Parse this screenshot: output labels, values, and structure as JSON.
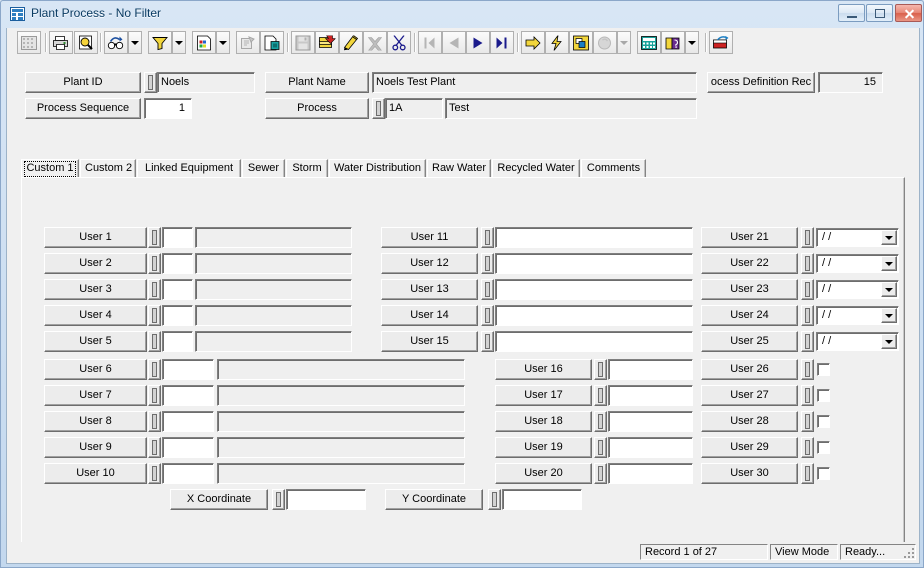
{
  "window": {
    "title": "Plant Process - No Filter",
    "icon": "grid-table-icon",
    "buttons": {
      "minimize": "minimize-button",
      "maximize": "restore-button",
      "close": "close-button"
    }
  },
  "toolbar": {
    "items": [
      {
        "name": "grid-view-icon",
        "enabled": false,
        "dropdown": false
      },
      {
        "name": "print-icon",
        "enabled": true,
        "dropdown": false
      },
      {
        "name": "print-preview-icon",
        "enabled": true,
        "dropdown": false
      },
      {
        "name": "find-icon",
        "enabled": true,
        "dropdown": true
      },
      {
        "name": "filter-icon",
        "enabled": true,
        "dropdown": true
      },
      {
        "name": "report-icon",
        "enabled": true,
        "dropdown": true
      },
      {
        "name": "form-design-icon",
        "enabled": false,
        "dropdown": false
      },
      {
        "name": "copy-record-icon",
        "enabled": true,
        "dropdown": false
      },
      {
        "name": "save-icon",
        "enabled": false,
        "dropdown": false
      },
      {
        "name": "add-record-icon",
        "enabled": true,
        "dropdown": false
      },
      {
        "name": "edit-record-icon",
        "enabled": true,
        "dropdown": false
      },
      {
        "name": "delete-record-icon",
        "enabled": false,
        "dropdown": false
      },
      {
        "name": "cut-icon",
        "enabled": true,
        "dropdown": false
      },
      {
        "name": "first-record-icon",
        "enabled": false,
        "dropdown": false
      },
      {
        "name": "previous-record-icon",
        "enabled": false,
        "dropdown": false
      },
      {
        "name": "next-record-icon",
        "enabled": true,
        "dropdown": false
      },
      {
        "name": "last-record-icon",
        "enabled": true,
        "dropdown": false
      },
      {
        "name": "goto-icon",
        "enabled": true,
        "dropdown": false
      },
      {
        "name": "quick-action-icon",
        "enabled": true,
        "dropdown": false
      },
      {
        "name": "map-icon",
        "enabled": true,
        "dropdown": false
      },
      {
        "name": "attachment-icon",
        "enabled": false,
        "dropdown": true
      },
      {
        "name": "calculator-icon",
        "enabled": true,
        "dropdown": false
      },
      {
        "name": "help-book-icon",
        "enabled": true,
        "dropdown": true
      },
      {
        "name": "exit-icon",
        "enabled": true,
        "dropdown": false
      }
    ]
  },
  "header": {
    "plant_id": {
      "label": "Plant ID",
      "value": "Noels"
    },
    "plant_name": {
      "label": "Plant Name",
      "value": "Noels Test Plant"
    },
    "process_definition": {
      "label": "ocess Definition Rec",
      "value": "15"
    },
    "process_sequence": {
      "label": "Process Sequence",
      "value": "1"
    },
    "process": {
      "label": "Process",
      "value": "1A",
      "description": "Test"
    }
  },
  "tabs": [
    {
      "label": "Custom 1",
      "selected": true
    },
    {
      "label": "Custom 2",
      "selected": false
    },
    {
      "label": "Linked Equipment",
      "selected": false
    },
    {
      "label": "Sewer",
      "selected": false
    },
    {
      "label": "Storm",
      "selected": false
    },
    {
      "label": "Water Distribution",
      "selected": false
    },
    {
      "label": "Raw Water",
      "selected": false
    },
    {
      "label": "Recycled Water",
      "selected": false
    },
    {
      "label": "Comments",
      "selected": false
    }
  ],
  "custom1": {
    "col_a": [
      {
        "label": "User 1",
        "value": "",
        "desc": ""
      },
      {
        "label": "User 2",
        "value": "",
        "desc": ""
      },
      {
        "label": "User 3",
        "value": "",
        "desc": ""
      },
      {
        "label": "User 4",
        "value": "",
        "desc": ""
      },
      {
        "label": "User 5",
        "value": "",
        "desc": ""
      }
    ],
    "col_a2": [
      {
        "label": "User 6",
        "value": "",
        "desc": ""
      },
      {
        "label": "User 7",
        "value": "",
        "desc": ""
      },
      {
        "label": "User 8",
        "value": "",
        "desc": ""
      },
      {
        "label": "User 9",
        "value": "",
        "desc": ""
      },
      {
        "label": "User 10",
        "value": "",
        "desc": ""
      }
    ],
    "col_b": [
      {
        "label": "User 11",
        "value": ""
      },
      {
        "label": "User 12",
        "value": ""
      },
      {
        "label": "User 13",
        "value": ""
      },
      {
        "label": "User 14",
        "value": ""
      },
      {
        "label": "User 15",
        "value": ""
      }
    ],
    "col_b2": [
      {
        "label": "User 16",
        "value": ""
      },
      {
        "label": "User 17",
        "value": ""
      },
      {
        "label": "User 18",
        "value": ""
      },
      {
        "label": "User 19",
        "value": ""
      },
      {
        "label": "User 20",
        "value": ""
      }
    ],
    "col_c": [
      {
        "label": "User 21",
        "value": "  /  /"
      },
      {
        "label": "User 22",
        "value": "  /  /"
      },
      {
        "label": "User 23",
        "value": "  /  /"
      },
      {
        "label": "User 24",
        "value": "  /  /"
      },
      {
        "label": "User 25",
        "value": "  /  /"
      }
    ],
    "col_c2": [
      {
        "label": "User 26",
        "checked": false
      },
      {
        "label": "User 27",
        "checked": false
      },
      {
        "label": "User 28",
        "checked": false
      },
      {
        "label": "User 29",
        "checked": false
      },
      {
        "label": "User 30",
        "checked": false
      }
    ],
    "coords": {
      "x": {
        "label": "X Coordinate",
        "value": ""
      },
      "y": {
        "label": "Y Coordinate",
        "value": ""
      }
    }
  },
  "statusbar": {
    "record": "Record 1 of 27",
    "mode": "View Mode",
    "state": "Ready..."
  }
}
